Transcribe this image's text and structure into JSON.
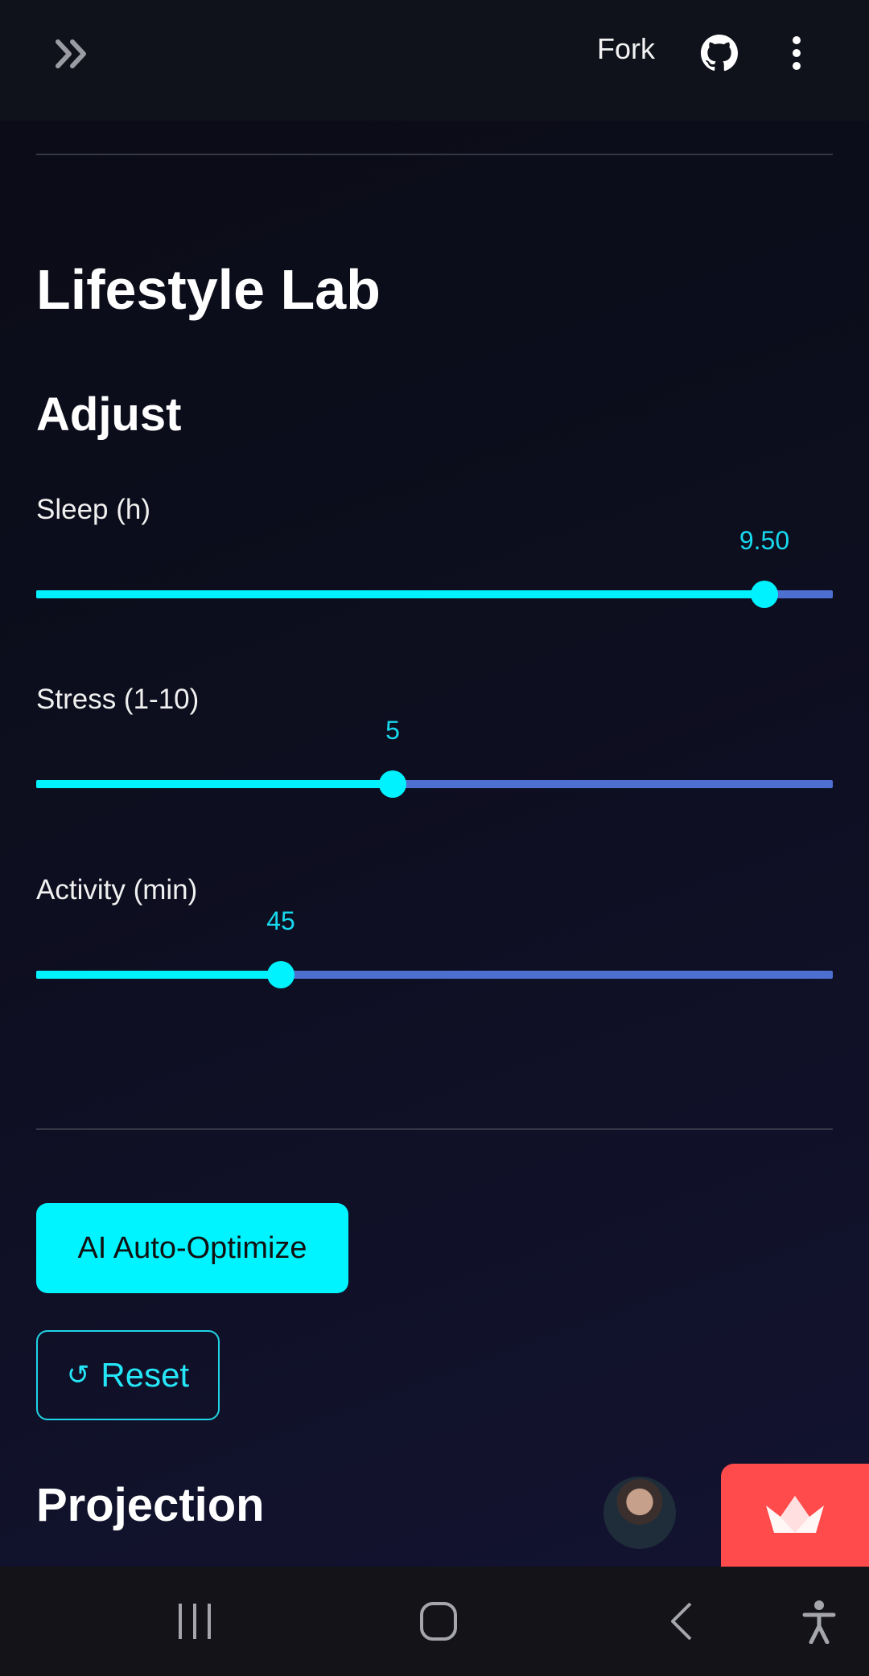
{
  "header": {
    "fork_label": "Fork",
    "icons": [
      "double-chevron-right-icon",
      "github-icon",
      "kebab-menu-icon"
    ]
  },
  "page": {
    "title": "Lifestyle Lab",
    "adjust_heading": "Adjust",
    "projection_heading": "Projection"
  },
  "sliders": [
    {
      "label": "Sleep (h)",
      "value": "9.50",
      "fraction": 0.914
    },
    {
      "label": "Stress (1-10)",
      "value": "5",
      "fraction": 0.447
    },
    {
      "label": "Activity (min)",
      "value": "45",
      "fraction": 0.307
    }
  ],
  "actions": {
    "ai_optimize_label": "AI Auto-Optimize",
    "reset_label": "Reset",
    "reset_icon": "↺"
  },
  "colors": {
    "accent": "#00f4ff",
    "track": "#4d70d0",
    "badge": "#ff4b4b"
  },
  "system_nav": {
    "icons": [
      "recent-apps-icon",
      "home-icon",
      "back-icon",
      "accessibility-icon"
    ]
  }
}
